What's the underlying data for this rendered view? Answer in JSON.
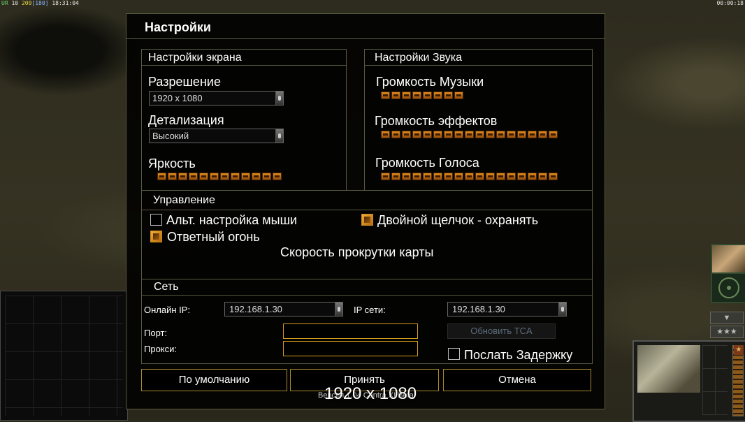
{
  "hud": {
    "top_left": {
      "part1": "UR",
      "part2": "10",
      "part3": "200",
      "part4": "[180]",
      "time": "18:31:04"
    },
    "top_right": "00:00:18",
    "stars": "★★★"
  },
  "dialog": {
    "title": "Настройки",
    "screen": {
      "title": "Настройки экрана",
      "resolution_label": "Разрешение",
      "resolution_value": "1920 x 1080",
      "detail_label": "Детализация",
      "detail_value": "Высокий",
      "brightness_label": "Яркость",
      "brightness_segments": 12
    },
    "sound": {
      "title": "Настройки Звука",
      "music_label": "Громкость Музыки",
      "music_segments": 8,
      "effects_label": "Громкость эффектов",
      "effects_segments": 17,
      "voice_label": "Громкость Голоса",
      "voice_segments": 17
    },
    "control": {
      "title": "Управление",
      "alt_mouse_label": "Альт. настройка мыши",
      "alt_mouse_checked": false,
      "double_click_label": "Двойной щелчок - охранять",
      "double_click_checked": true,
      "return_fire_label": "Ответный огонь",
      "return_fire_checked": true,
      "scroll_speed_label": "Скорость прокрутки карты"
    },
    "network": {
      "title": "Сеть",
      "online_ip_label": "Онлайн IP:",
      "online_ip_value": "192.168.1.30",
      "lan_ip_label": "IP сети:",
      "lan_ip_value": "192.168.1.30",
      "port_label": "Порт:",
      "port_value": "",
      "proxy_label": "Прокси:",
      "proxy_value": "",
      "update_tca_label": "Обновить TCA",
      "send_delay_label": "Послать Задержку",
      "send_delay_checked": false
    },
    "buttons": {
      "default": "По умолчанию",
      "accept": "Принять",
      "cancel": "Отмена"
    }
  },
  "footer": {
    "version_text": "Версия 1.04 Contra XI Beta",
    "resolution_overlay": "1920 x 1080"
  },
  "colors": {
    "accent_orange": "#e08a1e",
    "border": "#5a5a40",
    "button_border": "#a88a30"
  }
}
